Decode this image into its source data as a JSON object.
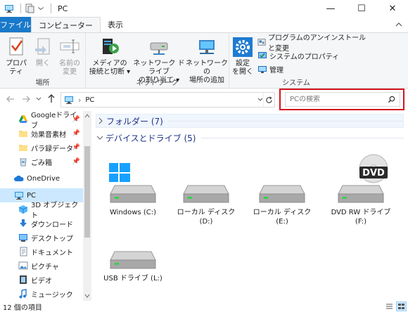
{
  "window": {
    "title": "PC",
    "minimize": "—",
    "maximize": "☐",
    "close": "✕"
  },
  "ribbon_tabs": [
    {
      "label": "ファイル"
    },
    {
      "label": "コンピューター"
    },
    {
      "label": "表示"
    }
  ],
  "ribbon": {
    "location": {
      "label": "場所",
      "properties": "プロパティ",
      "open": "開く",
      "rename_line1": "名前の",
      "rename_line2": "変更"
    },
    "network": {
      "label": "ネットワーク",
      "media_line1": "メディアの",
      "media_line2": "接続と切断 ▾",
      "map_drive_line1": "ネットワーク ドライブ",
      "map_drive_line2": "の割り当て ▾",
      "add_location_line1": "ネットワークの",
      "add_location_line2": "場所の追加"
    },
    "system": {
      "label": "システム",
      "settings_line1": "設定",
      "settings_line2": "を開く",
      "uninstall": "プログラムのアンインストールと変更",
      "system_properties": "システムのプロパティ",
      "manage": "管理"
    }
  },
  "address": {
    "path": "PC",
    "sep": "›"
  },
  "search": {
    "placeholder": "PCの検索"
  },
  "sidebar": {
    "items": [
      {
        "label": "Googleドライブ",
        "icon": "google-drive-icon",
        "pinned": true
      },
      {
        "label": "効果音素材",
        "icon": "folder-icon",
        "pinned": true
      },
      {
        "label": "パラ録データ",
        "icon": "folder-icon",
        "pinned": true
      },
      {
        "label": "ごみ箱",
        "icon": "recycle-bin-icon",
        "pinned": true
      },
      {
        "label": "OneDrive",
        "icon": "onedrive-icon",
        "pinned": false
      },
      {
        "label": "PC",
        "icon": "pc-icon",
        "pinned": false,
        "selected": true
      },
      {
        "label": "3D オブジェクト",
        "icon": "3d-objects-icon",
        "pinned": false
      },
      {
        "label": "ダウンロード",
        "icon": "download-icon",
        "pinned": false
      },
      {
        "label": "デスクトップ",
        "icon": "desktop-icon",
        "pinned": false
      },
      {
        "label": "ドキュメント",
        "icon": "documents-icon",
        "pinned": false
      },
      {
        "label": "ピクチャ",
        "icon": "pictures-icon",
        "pinned": false
      },
      {
        "label": "ビデオ",
        "icon": "videos-icon",
        "pinned": false
      },
      {
        "label": "ミュージック",
        "icon": "music-icon",
        "pinned": false
      }
    ]
  },
  "content": {
    "folders_header": "フォルダー (7)",
    "devices_header": "デバイスとドライブ (5)",
    "drives": [
      {
        "line1": "Windows (C:)",
        "line2": ""
      },
      {
        "line1": "ローカル ディスク",
        "line2": "(D:)"
      },
      {
        "line1": "ローカル ディスク",
        "line2": "(E:)"
      },
      {
        "line1": "DVD RW ドライブ",
        "line2": "(F:)"
      },
      {
        "line1": "USB ドライブ (L:)",
        "line2": ""
      }
    ],
    "dvd_badge": "DVD"
  },
  "status": {
    "item_count": "12 個の項目"
  },
  "colors": {
    "file_tab": "#1979ca",
    "selected": "#cce8ff",
    "search_highlight": "#d4141b"
  }
}
